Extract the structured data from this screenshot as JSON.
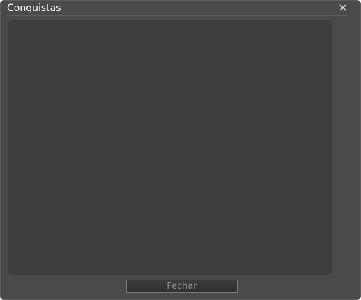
{
  "window": {
    "title": "Conquistas"
  },
  "footer": {
    "close_label": "Fechar"
  },
  "icons": {
    "close": "close-icon"
  },
  "colors": {
    "window_bg": "#4a4a4a",
    "panel_bg": "#3e3e3e",
    "title_text": "#ffffff",
    "button_text": "#8c8c8c"
  }
}
